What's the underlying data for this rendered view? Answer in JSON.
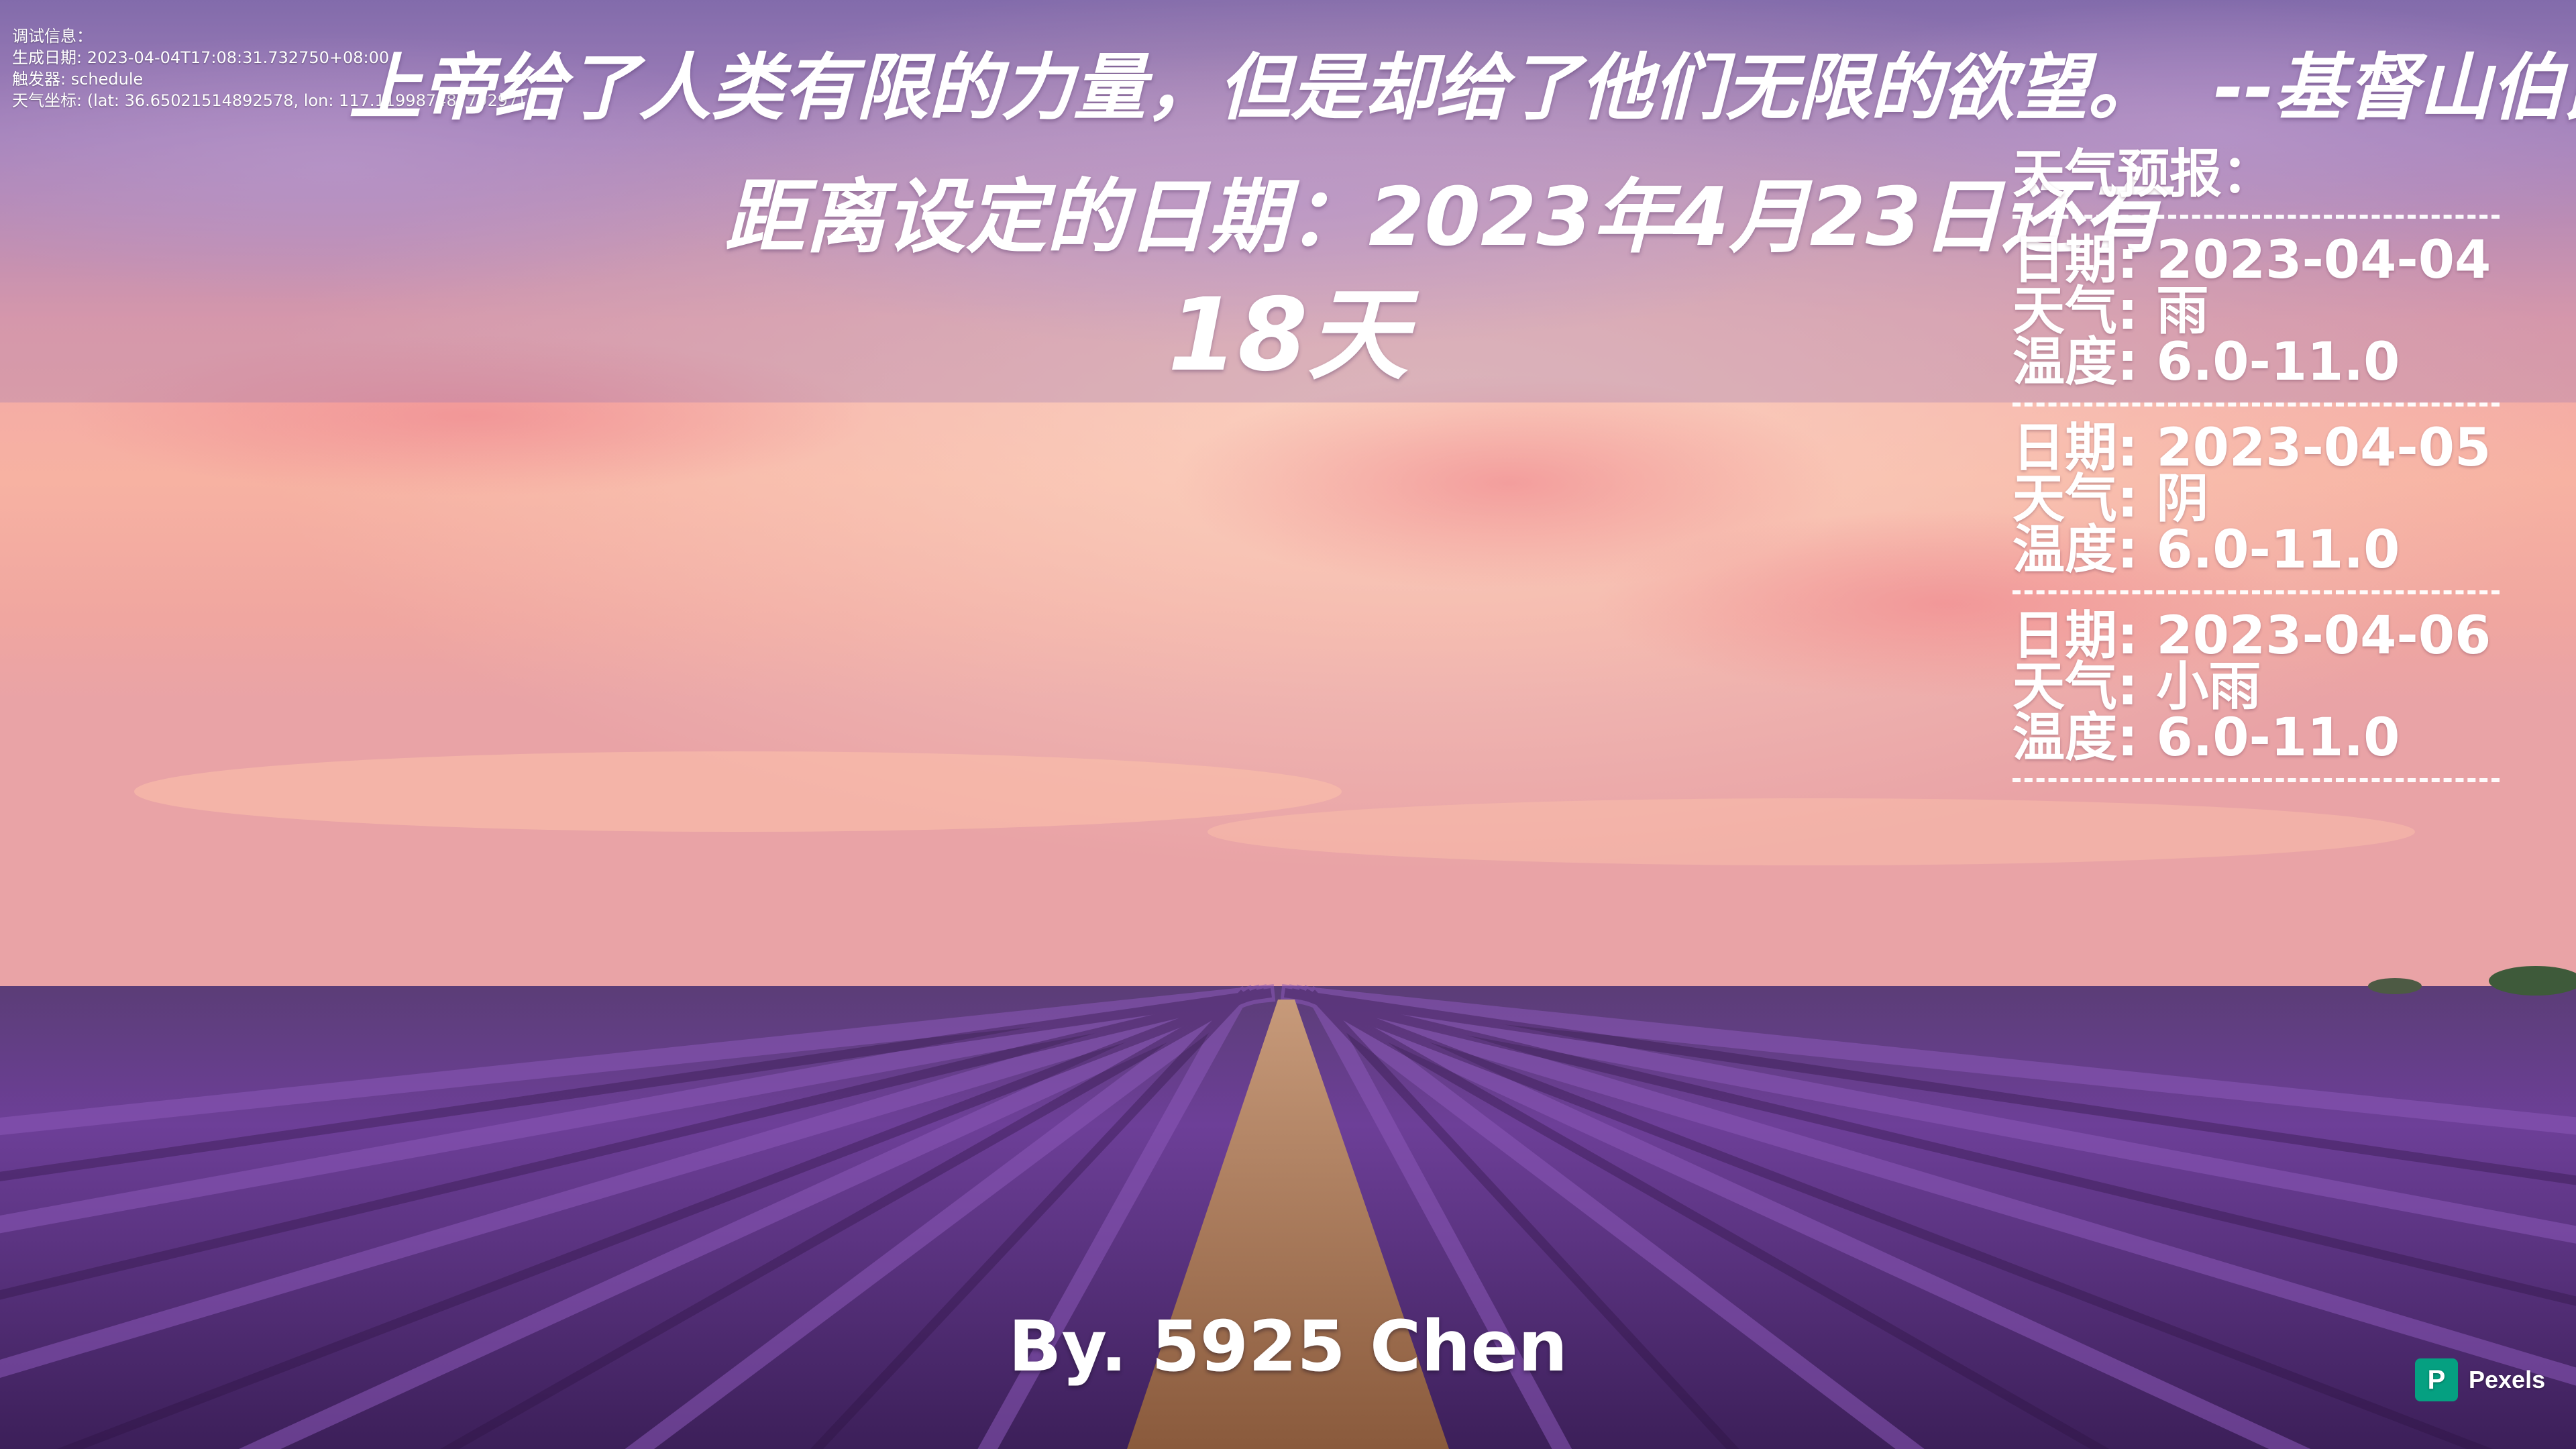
{
  "debug": {
    "header": "调试信息：",
    "generated_at": "生成日期: 2023-04-04T17:08:31.732750+08:00",
    "trigger": "触发器: schedule",
    "weather_coords": "天气坐标: (lat: 36.65021514892578, lon: 117.11998748779297)"
  },
  "quote": {
    "text": "上帝给了人类有限的力量，但是却给了他们无限的欲望。",
    "author": "--基督山伯爵"
  },
  "countdown": {
    "label": "距离设定的日期：2023年4月23日还有",
    "days": "18天"
  },
  "weather": {
    "title": "天气预报：",
    "forecasts": [
      {
        "date": "日期: 2023-04-04",
        "condition": "天气: 雨",
        "temp": "温度: 6.0-11.0"
      },
      {
        "date": "日期: 2023-04-05",
        "condition": "天气: 阴",
        "temp": "温度: 6.0-11.0"
      },
      {
        "date": "日期: 2023-04-06",
        "condition": "天气: 小雨",
        "temp": "温度: 6.0-11.0"
      }
    ]
  },
  "signature": "By. 5925 Chen",
  "watermark": {
    "label": "Pexels",
    "logo_glyph": "P"
  },
  "colors": {
    "sky_top": "#8f7bb8",
    "sky_mid": "#f2a29a",
    "horizon": "#f7b6a5",
    "lavender": "#6a3a94",
    "path": "#a9744f",
    "pexels_green": "#05a081"
  }
}
